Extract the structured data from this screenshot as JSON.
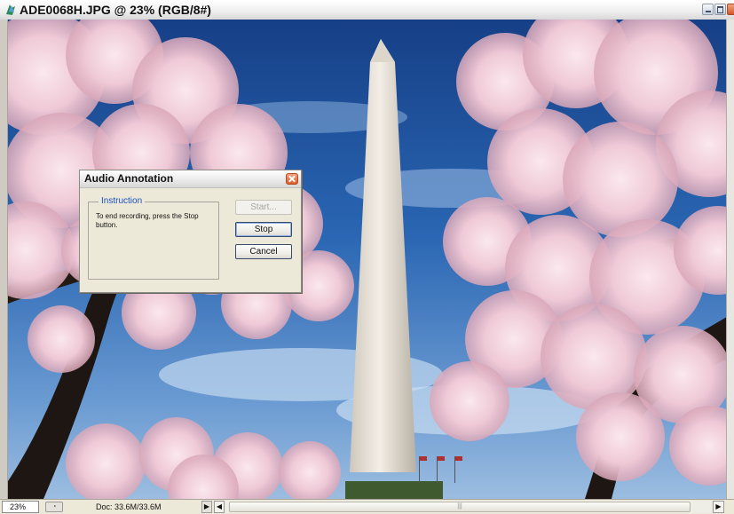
{
  "window": {
    "title": "ADE0068H.JPG @ 23% (RGB/8#)",
    "icon": "photoshop-document-icon",
    "controls": [
      "minimize-icon",
      "maximize-icon",
      "close-icon"
    ]
  },
  "status_bar": {
    "zoom": "23%",
    "doc_info": "Doc: 33.6M/33.6M",
    "menu_arrow": "▶",
    "scroll_left": "◀",
    "scroll_right": "▶",
    "scroll_grip": "|||"
  },
  "dialog": {
    "title": "Audio Annotation",
    "group_label": "Instruction",
    "instruction_text": "To end recording, press the Stop button.",
    "buttons": {
      "start": "Start...",
      "stop": "Stop",
      "cancel": "Cancel"
    },
    "start_enabled": false,
    "default_button": "stop"
  },
  "colors": {
    "sky": "#2f6bb7",
    "dialog_face": "#ece9d8",
    "group_label": "#1c4fc4",
    "close_button": "#d95c2c"
  }
}
